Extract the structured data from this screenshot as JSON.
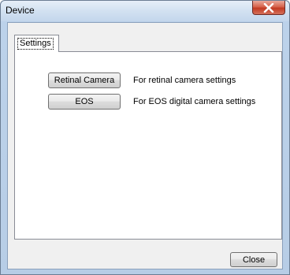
{
  "window": {
    "title": "Device",
    "close_icon": "close-x-icon"
  },
  "tabs": [
    {
      "label": "Settings",
      "selected": true
    }
  ],
  "settings": {
    "items": [
      {
        "button_label": "Retinal Camera",
        "description": "For retinal camera settings"
      },
      {
        "button_label": "EOS",
        "description": "For EOS digital camera settings"
      }
    ]
  },
  "footer": {
    "close_label": "Close"
  }
}
